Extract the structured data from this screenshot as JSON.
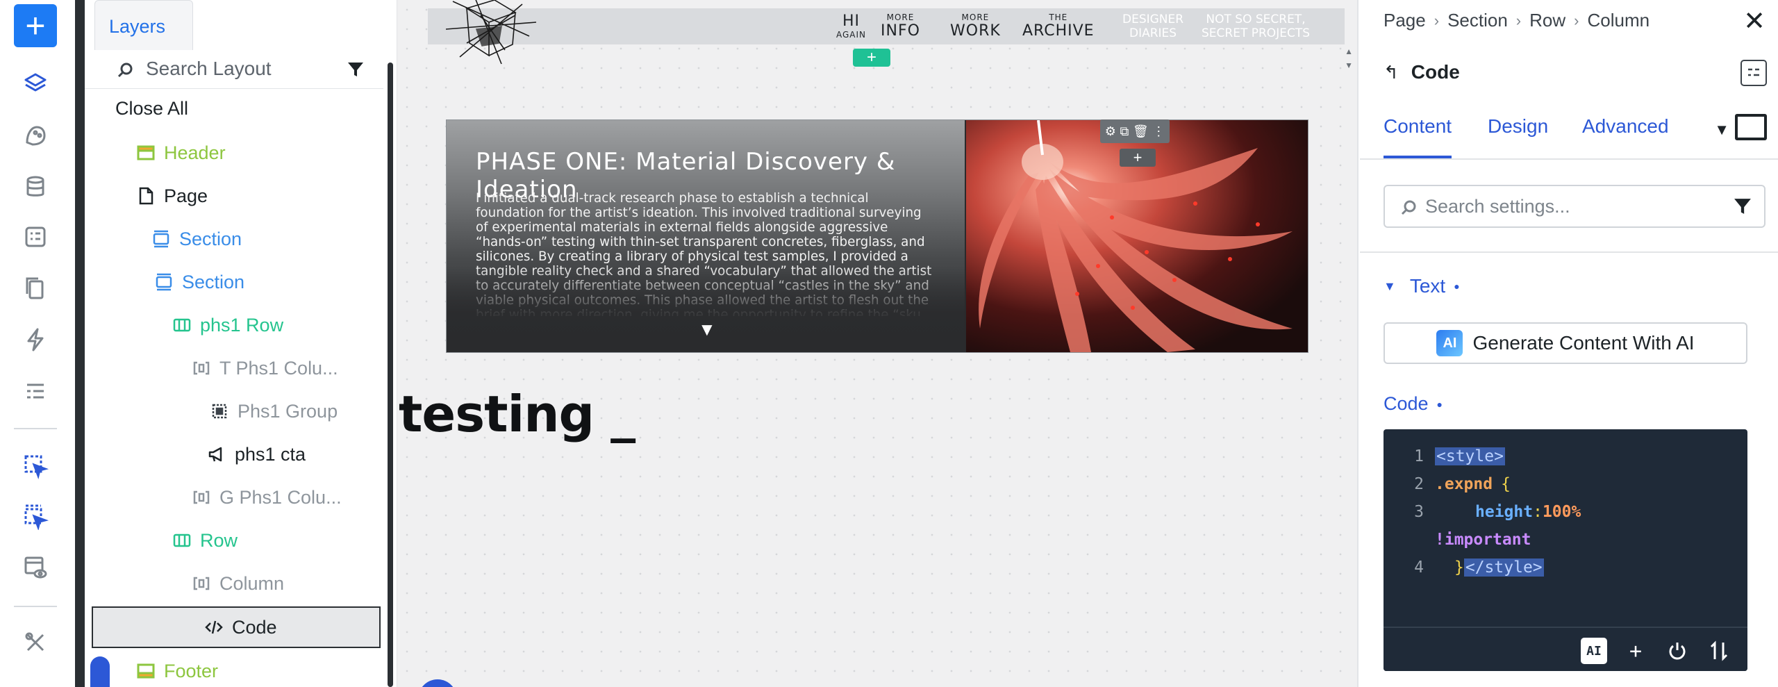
{
  "toolbar": {
    "add_label": "+",
    "icons": [
      "layers-icon",
      "palette-icon",
      "database-icon",
      "template-icon",
      "pages-icon",
      "lightning-icon",
      "list-icon",
      "interaction-icon",
      "multi-interaction-icon",
      "preview-icon",
      "tools-icon"
    ]
  },
  "layers": {
    "tab_label": "Layers",
    "search_label": "Search Layout",
    "close_all": "Close All",
    "tree": [
      {
        "label": "Header",
        "icon": "header-icon"
      },
      {
        "label": "Page",
        "icon": "page-icon"
      },
      {
        "label": "Section",
        "icon": "section-icon"
      },
      {
        "label": "Section",
        "icon": "section-icon"
      },
      {
        "label": "phs1 Row",
        "icon": "row-icon"
      },
      {
        "label": "T Phs1 Colu...",
        "icon": "column-icon"
      },
      {
        "label": "Phs1 Group",
        "icon": "group-icon"
      },
      {
        "label": "phs1 cta",
        "icon": "megaphone-icon"
      },
      {
        "label": "G Phs1 Colu...",
        "icon": "column-icon"
      },
      {
        "label": "Row",
        "icon": "row-icon"
      },
      {
        "label": "Column",
        "icon": "column-icon"
      },
      {
        "label": "Code",
        "icon": "code-icon"
      },
      {
        "label": "Footer",
        "icon": "footer-icon"
      }
    ]
  },
  "canvas": {
    "nav": {
      "hi_big": "HI",
      "hi_small": "AGAIN",
      "info_small": "MORE",
      "info_big": "INFO",
      "work_small": "MORE",
      "work_big": "WORK",
      "archive_small": "THE",
      "archive_big": "ARCHIVE",
      "diaries_line1": "DESIGNER",
      "diaries_line2": "DIARIES",
      "secret_line1": "NOT SO SECRET,",
      "secret_line2": "SECRET PROJECTS"
    },
    "add_section": "+",
    "hero": {
      "title": "PHASE ONE: Material Discovery & Ideation",
      "body": "I initiated a dual-track research phase to establish a technical foundation for the artist’s ideation. This involved traditional surveying of experimental materials in external fields alongside aggressive “hands-on” testing with thin-set transparent concretes, fiberglass, and silicones. By creating a library of physical test samples, I provided a tangible reality check and a shared “vocabulary” that allowed the artist to accurately differentiate between conceptual “castles in the sky” and viable physical outcomes. This phase allowed the artist to flesh out the brief with more direction, giving me the opportunity to refine the “sku",
      "expand_arrow": "▼"
    },
    "element_add": "+",
    "testing_text": "testing _"
  },
  "settings": {
    "breadcrumb": [
      "Page",
      "Section",
      "Row",
      "Column"
    ],
    "element_name": "Code",
    "tabs": [
      "Content",
      "Design",
      "Advanced"
    ],
    "active_tab": "Content",
    "search_placeholder": "Search settings...",
    "text_section": "Text",
    "ai_button": "Generate Content With AI",
    "ai_badge": "AI",
    "code_label": "Code",
    "code_lines": [
      {
        "num": "1",
        "open_tag": "<style>"
      },
      {
        "num": "2",
        "selector": ".expnd",
        "brace": "{"
      },
      {
        "num": "3",
        "prop": "height",
        "colon": ":",
        "value": "100%"
      },
      {
        "num": "",
        "important": "!important"
      },
      {
        "num": "4",
        "brace_close": "}",
        "close_tag": "</style>"
      }
    ]
  },
  "colors": {
    "accent": "#2c58d6",
    "add_button": "#1d7bf4",
    "canvas_add": "#1fc195",
    "code_bg": "#1f2a38"
  }
}
